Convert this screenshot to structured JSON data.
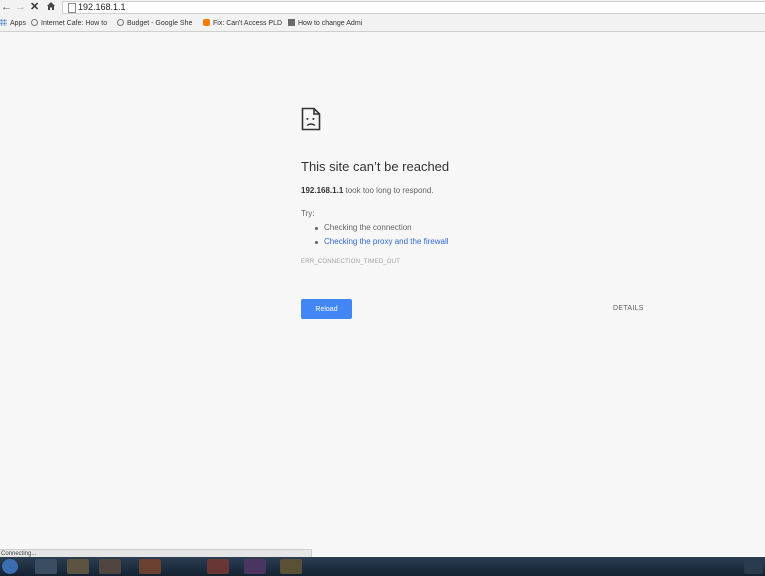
{
  "toolbar": {
    "back_icon": "back-arrow-icon",
    "forward_icon": "forward-arrow-icon",
    "stop_icon": "stop-icon",
    "home_icon": "home-icon",
    "url": "192.168.1.1"
  },
  "bookmarks": [
    {
      "label": "Apps",
      "icon": "apps-grid-icon"
    },
    {
      "label": "Internet Cafe: How to",
      "icon": "globe-icon"
    },
    {
      "label": "Budget - Google She",
      "icon": "globe-icon"
    },
    {
      "label": "Fix: Can't Access PLD",
      "icon": "blogger-icon"
    },
    {
      "label": "How to change Admi",
      "icon": "page-icon"
    }
  ],
  "error": {
    "title": "This site can’t be reached",
    "host": "192.168.1.1",
    "message": " took too long to respond.",
    "try_label": "Try:",
    "suggestions": [
      "Checking the connection",
      "Checking the proxy and the firewall"
    ],
    "code": "ERR_CONNECTION_TIMED_OUT",
    "reload_label": "Reload",
    "details_label": "DETAILS"
  },
  "status": {
    "text": "Connecting..."
  },
  "colors": {
    "accent": "#4285f4",
    "link": "#3367d6",
    "page_bg": "#f7f7f7"
  }
}
